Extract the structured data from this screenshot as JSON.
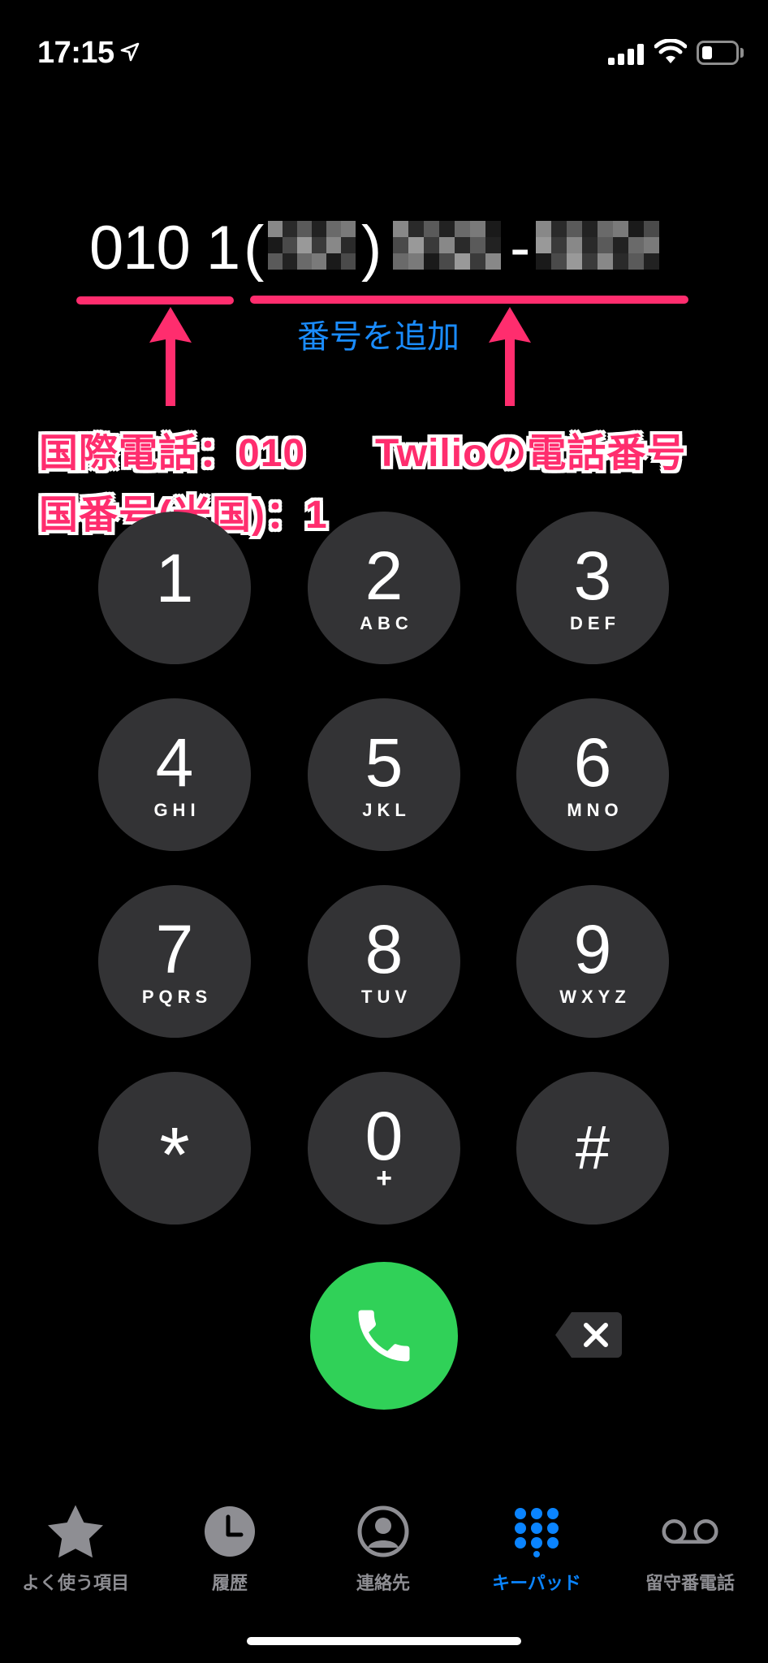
{
  "status_bar": {
    "time": "17:15"
  },
  "dialer": {
    "country_part": "010 1",
    "paren_open": "(",
    "paren_close": ")",
    "dash": "-",
    "add_number_label": "番号を追加"
  },
  "annotations": {
    "international_call": "国際電話：010",
    "country_code": "国番号(米国)：1",
    "twilio_number": "Twilioの電話番号",
    "accent_color": "#ff2d6e"
  },
  "keypad": {
    "keys": [
      {
        "digit": "1",
        "letters": ""
      },
      {
        "digit": "2",
        "letters": "ABC"
      },
      {
        "digit": "3",
        "letters": "DEF"
      },
      {
        "digit": "4",
        "letters": "GHI"
      },
      {
        "digit": "5",
        "letters": "JKL"
      },
      {
        "digit": "6",
        "letters": "MNO"
      },
      {
        "digit": "7",
        "letters": "PQRS"
      },
      {
        "digit": "8",
        "letters": "TUV"
      },
      {
        "digit": "9",
        "letters": "WXYZ"
      },
      {
        "digit": "*",
        "letters": ""
      },
      {
        "digit": "0",
        "letters": "+"
      },
      {
        "digit": "#",
        "letters": ""
      }
    ],
    "call_color": "#30d158",
    "key_color": "#333335"
  },
  "tab_bar": {
    "items": [
      {
        "label": "よく使う項目",
        "icon": "star-icon",
        "active": false
      },
      {
        "label": "履歴",
        "icon": "clock-icon",
        "active": false
      },
      {
        "label": "連絡先",
        "icon": "contact-icon",
        "active": false
      },
      {
        "label": "キーパッド",
        "icon": "keypad-icon",
        "active": true
      },
      {
        "label": "留守番電話",
        "icon": "voicemail-icon",
        "active": false
      }
    ],
    "active_color": "#0a84ff",
    "inactive_color": "#8e8e93"
  }
}
